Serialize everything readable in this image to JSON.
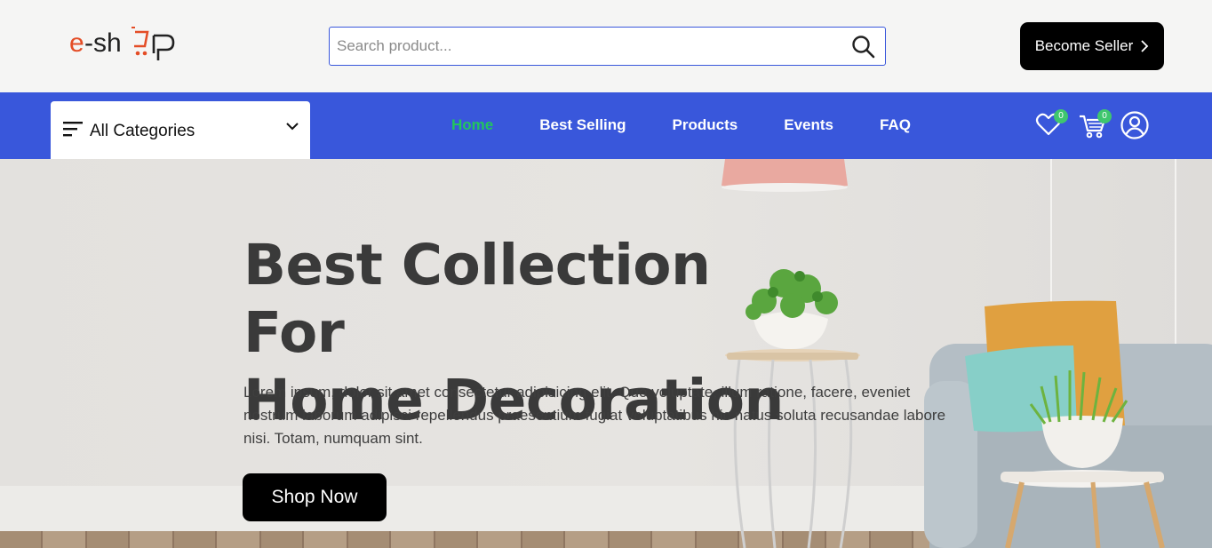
{
  "header": {
    "logo_text": "e-shop",
    "search": {
      "placeholder": "Search product...",
      "value": ""
    },
    "become_seller_label": "Become Seller",
    "become_seller_icon": "chevron-right-icon"
  },
  "nav": {
    "categories_label": "All Categories",
    "links": [
      {
        "label": "Home",
        "active": true
      },
      {
        "label": "Best Selling",
        "active": false
      },
      {
        "label": "Products",
        "active": false
      },
      {
        "label": "Events",
        "active": false
      },
      {
        "label": "FAQ",
        "active": false
      }
    ],
    "wishlist_count": "0",
    "cart_count": "0"
  },
  "hero": {
    "title_line1": "Best Collection For",
    "title_line2": "Home Decoration",
    "description": "Lorem ipsum, dolor sit amet consectetur adipisicing elit. Quo voluptate, illum ratione, facere, eveniet nostrum laborum adipisci repellendus praesentium fugiat voluptatibus hic natus soluta recusandae labore nisi. Totam, numquam sint.",
    "cta_label": "Shop Now"
  },
  "colors": {
    "brand_blue": "#3957db",
    "active_green": "#22c55e",
    "logo_red": "#e44d26",
    "badge_green": "#3fc66e"
  }
}
